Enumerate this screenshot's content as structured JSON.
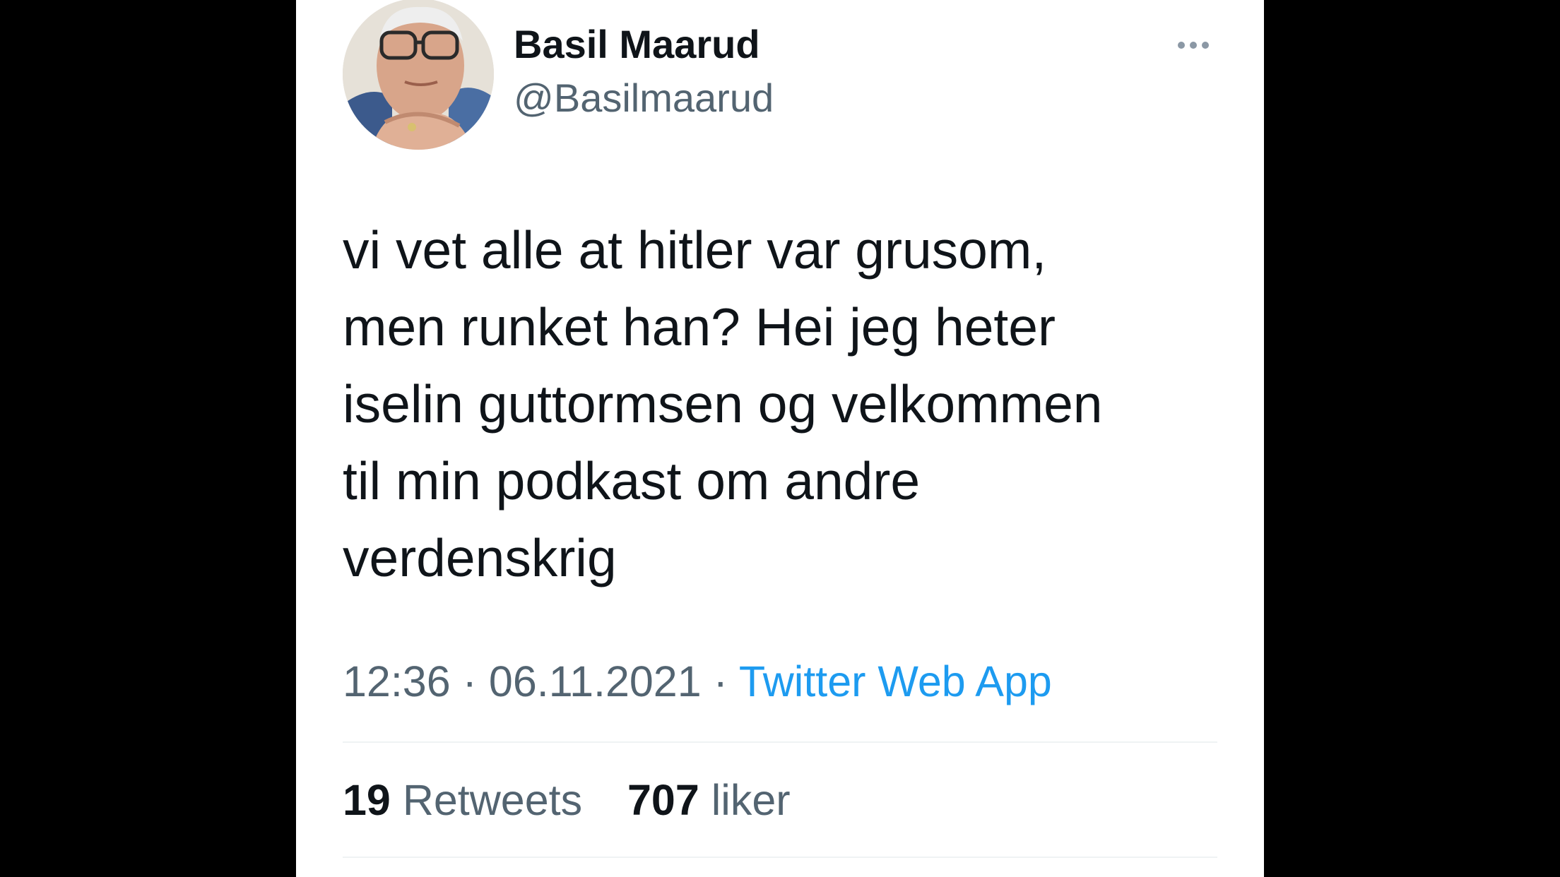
{
  "tweet": {
    "author": {
      "display_name": "Basil Maarud",
      "handle": "@Basilmaarud",
      "avatar_icon": "profile-photo"
    },
    "more_icon": "ellipsis-icon",
    "text_lines": [
      "vi vet alle at hitler var grusom,",
      "men runket han? Hei jeg heter",
      "iselin guttormsen og velkommen",
      "til min podkast om andre",
      "verdenskrig"
    ],
    "time": "12:36",
    "separator": "·",
    "date": "06.11.2021",
    "source": "Twitter Web App",
    "stats": {
      "retweets_count": "19",
      "retweets_label": "Retweets",
      "likes_count": "707",
      "likes_label": "liker"
    }
  },
  "colors": {
    "background": "#000000",
    "card": "#ffffff",
    "primary_text": "#0f1419",
    "secondary_text": "#536471",
    "link": "#1d9bf0",
    "divider": "#eff3f4"
  }
}
